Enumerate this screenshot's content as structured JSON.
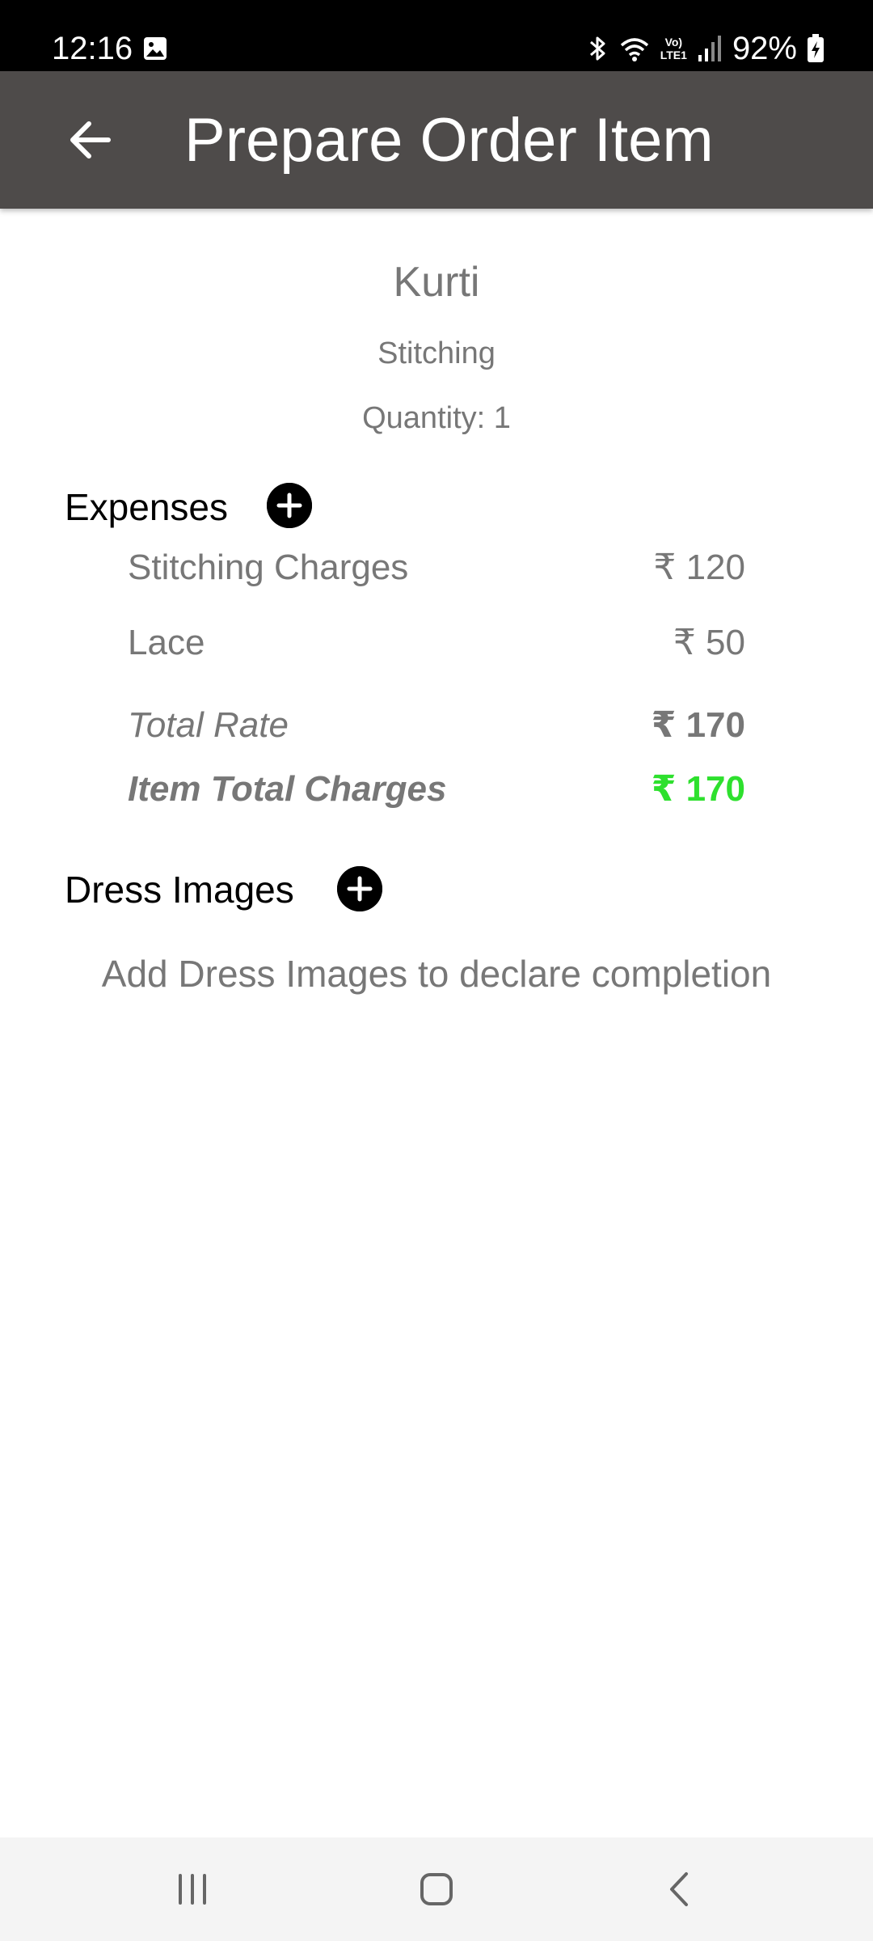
{
  "status_bar": {
    "time": "12:16",
    "battery": "92%",
    "volte_top": "Vo)",
    "volte_bottom": "LTE1",
    "icons": [
      "gallery-icon",
      "bluetooth-icon",
      "wifi-icon",
      "volte-icon",
      "signal-icon",
      "battery-charging-icon"
    ]
  },
  "app_bar": {
    "title": "Prepare Order Item",
    "back_icon": "arrow-left-icon"
  },
  "item": {
    "name": "Kurti",
    "service": "Stitching",
    "quantity": "Quantity: 1"
  },
  "expenses": {
    "title": "Expenses",
    "add_icon": "plus-circle-icon",
    "items": [
      {
        "label": "Stitching Charges",
        "value": "₹ 120"
      },
      {
        "label": "Lace",
        "value": "₹ 50"
      }
    ],
    "total_rate_label": "Total Rate",
    "total_rate_value": "₹ 170",
    "item_total_label": "Item Total Charges",
    "item_total_value": "₹ 170"
  },
  "dress_images": {
    "title": "Dress Images",
    "add_icon": "plus-circle-icon",
    "hint": "Add Dress Images to declare completion"
  },
  "nav_bar": {
    "icons": [
      "recents-icon",
      "home-icon",
      "back-icon"
    ]
  },
  "colors": {
    "app_bar": "#4e4b4a",
    "status_bar": "#000000",
    "secondary_text": "#777777",
    "accent_green": "#2ee02e",
    "nav_bar": "#f4f4f4"
  }
}
